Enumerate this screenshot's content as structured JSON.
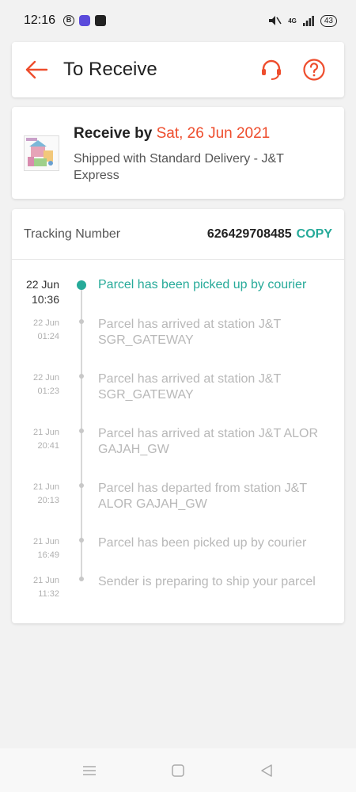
{
  "status_bar": {
    "time": "12:16",
    "signal_label": "4G",
    "battery": "43"
  },
  "header": {
    "title": "To Receive"
  },
  "delivery": {
    "receive_prefix": "Receive by",
    "receive_date": "Sat, 26 Jun 2021",
    "shipped_text": "Shipped with Standard Delivery  - J&T Express"
  },
  "tracking": {
    "label": "Tracking Number",
    "number": "626429708485",
    "copy_label": "COPY",
    "events": [
      {
        "date": "22 Jun",
        "time": "10:36",
        "text": "Parcel has been picked up by courier",
        "active": true
      },
      {
        "date": "22 Jun",
        "time": "01:24",
        "text": "Parcel has arrived at station J&T SGR_GATEWAY",
        "active": false
      },
      {
        "date": "22 Jun",
        "time": "01:23",
        "text": "Parcel has arrived at station J&T SGR_GATEWAY",
        "active": false
      },
      {
        "date": "21 Jun",
        "time": "20:41",
        "text": "Parcel has arrived at station J&T ALOR GAJAH_GW",
        "active": false
      },
      {
        "date": "21 Jun",
        "time": "20:13",
        "text": "Parcel has departed from station J&T ALOR GAJAH_GW",
        "active": false
      },
      {
        "date": "21 Jun",
        "time": "16:49",
        "text": "Parcel has been picked up by courier",
        "active": false
      },
      {
        "date": "21 Jun",
        "time": "11:32",
        "text": "Sender is preparing to ship your parcel",
        "active": false
      }
    ]
  },
  "colors": {
    "accent": "#ee4d2d",
    "teal": "#26aa99",
    "muted": "#b8b8b8"
  },
  "icons": {
    "back": "arrow-left-icon",
    "support": "headset-icon",
    "help": "question-circle-icon",
    "nav_menu": "menu-lines-icon",
    "nav_home": "square-icon",
    "nav_back": "triangle-back-icon"
  }
}
